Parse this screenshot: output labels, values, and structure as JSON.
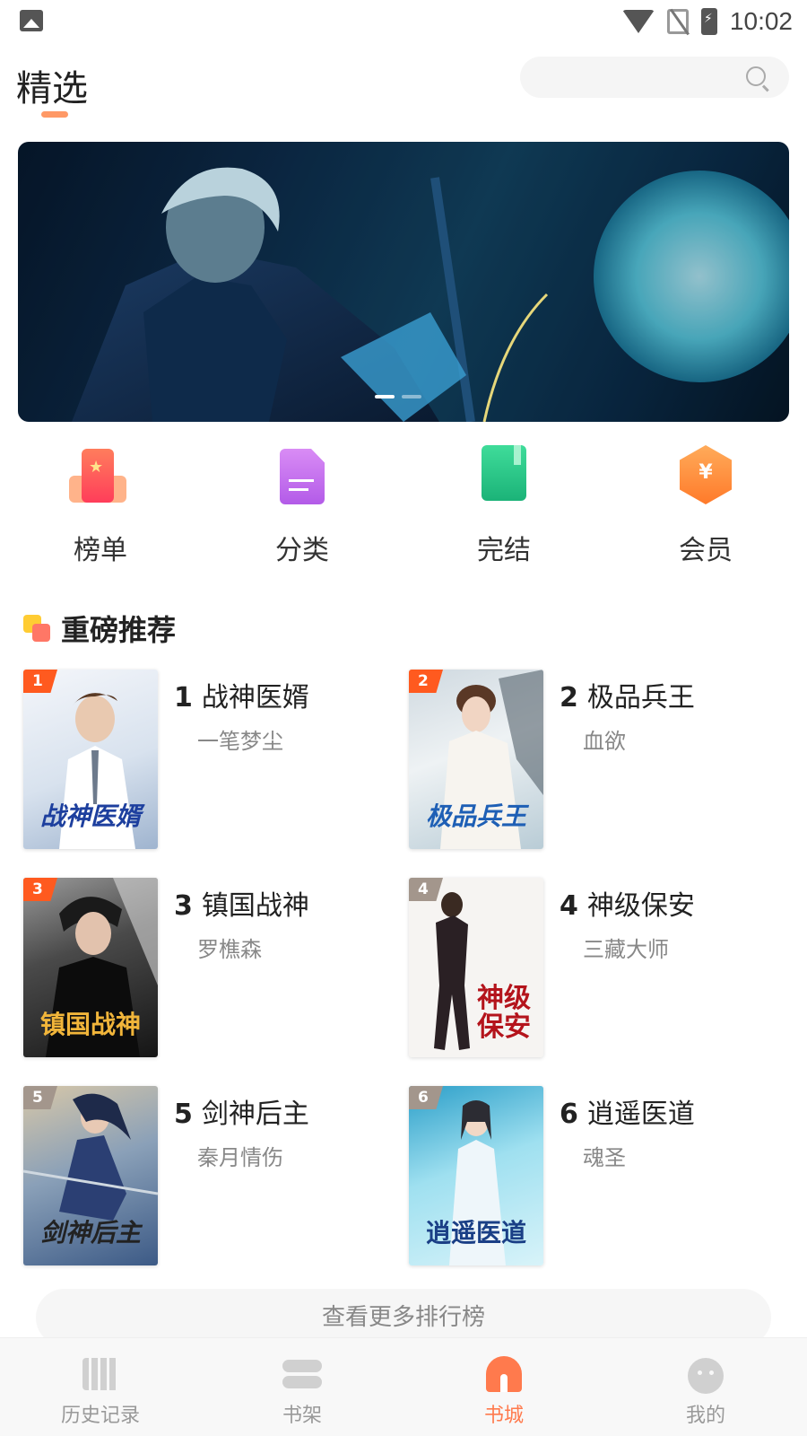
{
  "status_bar": {
    "time": "10:02"
  },
  "header": {
    "title": "精选",
    "search_placeholder": ""
  },
  "banner": {
    "slide_count": 2,
    "active_slide": 1
  },
  "quick_entries": [
    {
      "label": "榜单",
      "icon": "ranking-icon",
      "color": "#ff5a5a"
    },
    {
      "label": "分类",
      "icon": "category-document-icon",
      "color": "#c36bf0"
    },
    {
      "label": "完结",
      "icon": "finished-book-icon",
      "color": "#2ecc8a"
    },
    {
      "label": "会员",
      "icon": "vip-coin-icon",
      "color": "#ff8a3d"
    }
  ],
  "section": {
    "title": "重磅推荐"
  },
  "books": [
    {
      "rank": "1",
      "title": "战神医婿",
      "author": "一笔梦尘",
      "cover_text": "战神医婿",
      "badge_color": "#ff5a1f"
    },
    {
      "rank": "2",
      "title": "极品兵王",
      "author": "血欲",
      "cover_text": "极品兵王",
      "badge_color": "#ff5a1f"
    },
    {
      "rank": "3",
      "title": "镇国战神",
      "author": "罗樵森",
      "cover_text": "镇国战神",
      "badge_color": "#ff5a1f"
    },
    {
      "rank": "4",
      "title": "神级保安",
      "author": "三藏大师",
      "cover_text": "神级保安",
      "badge_color": "#a3968c"
    },
    {
      "rank": "5",
      "title": "剑神后主",
      "author": "秦月情伤",
      "cover_text": "剑神后主",
      "badge_color": "#a3968c"
    },
    {
      "rank": "6",
      "title": "逍遥医道",
      "author": "魂圣",
      "cover_text": "逍遥医道",
      "badge_color": "#a3968c"
    }
  ],
  "more_button": {
    "label": "查看更多排行榜"
  },
  "bottom_nav": [
    {
      "label": "历史记录",
      "icon": "history-icon",
      "active": false
    },
    {
      "label": "书架",
      "icon": "bookshelf-icon",
      "active": false
    },
    {
      "label": "书城",
      "icon": "bookstore-icon",
      "active": true
    },
    {
      "label": "我的",
      "icon": "profile-icon",
      "active": false
    }
  ],
  "colors": {
    "accent": "#ff7a4d",
    "text_primary": "#222222",
    "text_secondary": "#888888"
  }
}
